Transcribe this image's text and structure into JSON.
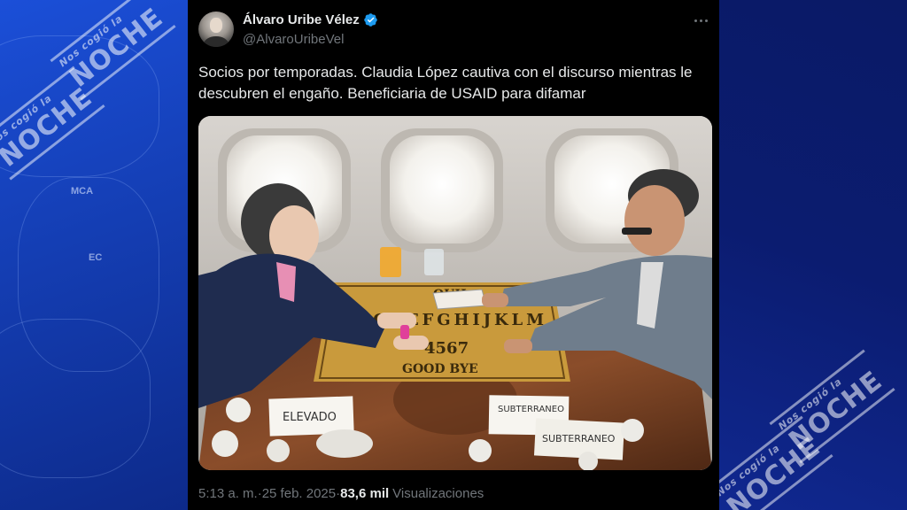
{
  "background": {
    "left_color": "#1540b8",
    "right_color": "#0b1c70",
    "watermark_small": "Nos cogió la",
    "watermark_big": "NOCHE",
    "map_labels": [
      "MCA",
      "EC"
    ]
  },
  "tweet": {
    "display_name": "Álvaro Uribe Vélez",
    "handle": "@AlvaroUribeVel",
    "verified_color": "#1d9bf0",
    "text": "Socios por temporadas. Claudia López cautiva con el discurso mientras le descubren el engaño. Beneficiaria de USAID para difamar",
    "media": {
      "board_top": "OUIJ",
      "board_alphabet": "ABCDEFGHIJKLM",
      "board_numbers": "4567",
      "board_bottom": "GOOD BYE",
      "note_left": "ELEVADO",
      "note_right_top": "SUBTERRANEO",
      "note_right_bottom": "SUBTERRANEO"
    },
    "time": "5:13 a. m.",
    "separator": " · ",
    "date": "25 feb. 2025",
    "separator2": " · ",
    "views_count": "83,6 mil",
    "views_label": "Visualizaciones"
  }
}
